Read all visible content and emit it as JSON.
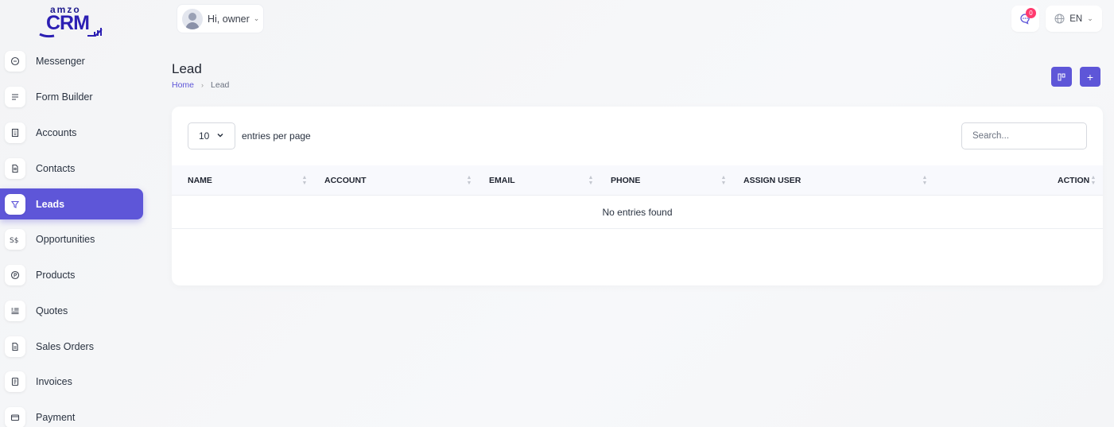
{
  "brand": {
    "logo_top": "amzo",
    "logo_main": "CRM"
  },
  "sidebar": {
    "items": [
      {
        "label": "Messenger",
        "icon": "chat-icon"
      },
      {
        "label": "Form Builder",
        "icon": "list-icon"
      },
      {
        "label": "Accounts",
        "icon": "building-icon"
      },
      {
        "label": "Contacts",
        "icon": "contact-file-icon"
      },
      {
        "label": "Leads",
        "icon": "filter-icon",
        "active": true
      },
      {
        "label": "Opportunities",
        "icon": "currency-icon"
      },
      {
        "label": "Products",
        "icon": "product-circle-icon"
      },
      {
        "label": "Quotes",
        "icon": "quote-list-icon"
      },
      {
        "label": "Sales Orders",
        "icon": "order-file-icon"
      },
      {
        "label": "Invoices",
        "icon": "invoice-icon"
      },
      {
        "label": "Payment",
        "icon": "card-icon"
      }
    ]
  },
  "header": {
    "greeting": "Hi, owner",
    "notifications": "0",
    "language": "EN"
  },
  "page": {
    "title": "Lead",
    "breadcrumb_home": "Home",
    "breadcrumb_current": "Lead"
  },
  "table": {
    "per_page_value": "10",
    "per_page_label": "entries per page",
    "search_placeholder": "Search...",
    "columns": [
      "NAME",
      "ACCOUNT",
      "EMAIL",
      "PHONE",
      "ASSIGN USER",
      "ACTION"
    ],
    "empty_text": "No entries found"
  },
  "colors": {
    "accent": "#5e56d8",
    "badge": "#ff3a6e"
  }
}
